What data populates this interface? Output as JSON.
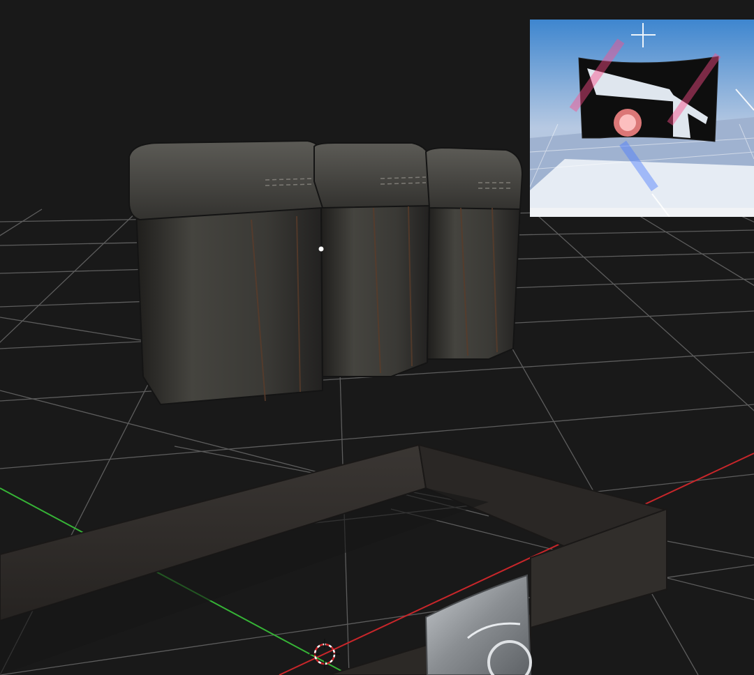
{
  "viewport": {
    "background": "#191919",
    "grid_color": "#6e6e6e",
    "x_axis_color": "#c8262a",
    "y_axis_color": "#36b436"
  },
  "objects": {
    "pouch": {
      "icon": "ammo-pouch-model",
      "color": "#3a3935"
    },
    "belt": {
      "icon": "belt-model",
      "color": "#2f2c2a"
    },
    "buckle": {
      "icon": "belt-buckle-model",
      "color": "#9a9ea2"
    }
  },
  "cursor": {
    "icon": "3d-cursor-icon"
  },
  "preview": {
    "icon": "flag-preview",
    "sky_color": "#4a8fd0",
    "floor_color": "#e6ecf4",
    "flag_color": "#0e0e0e"
  }
}
